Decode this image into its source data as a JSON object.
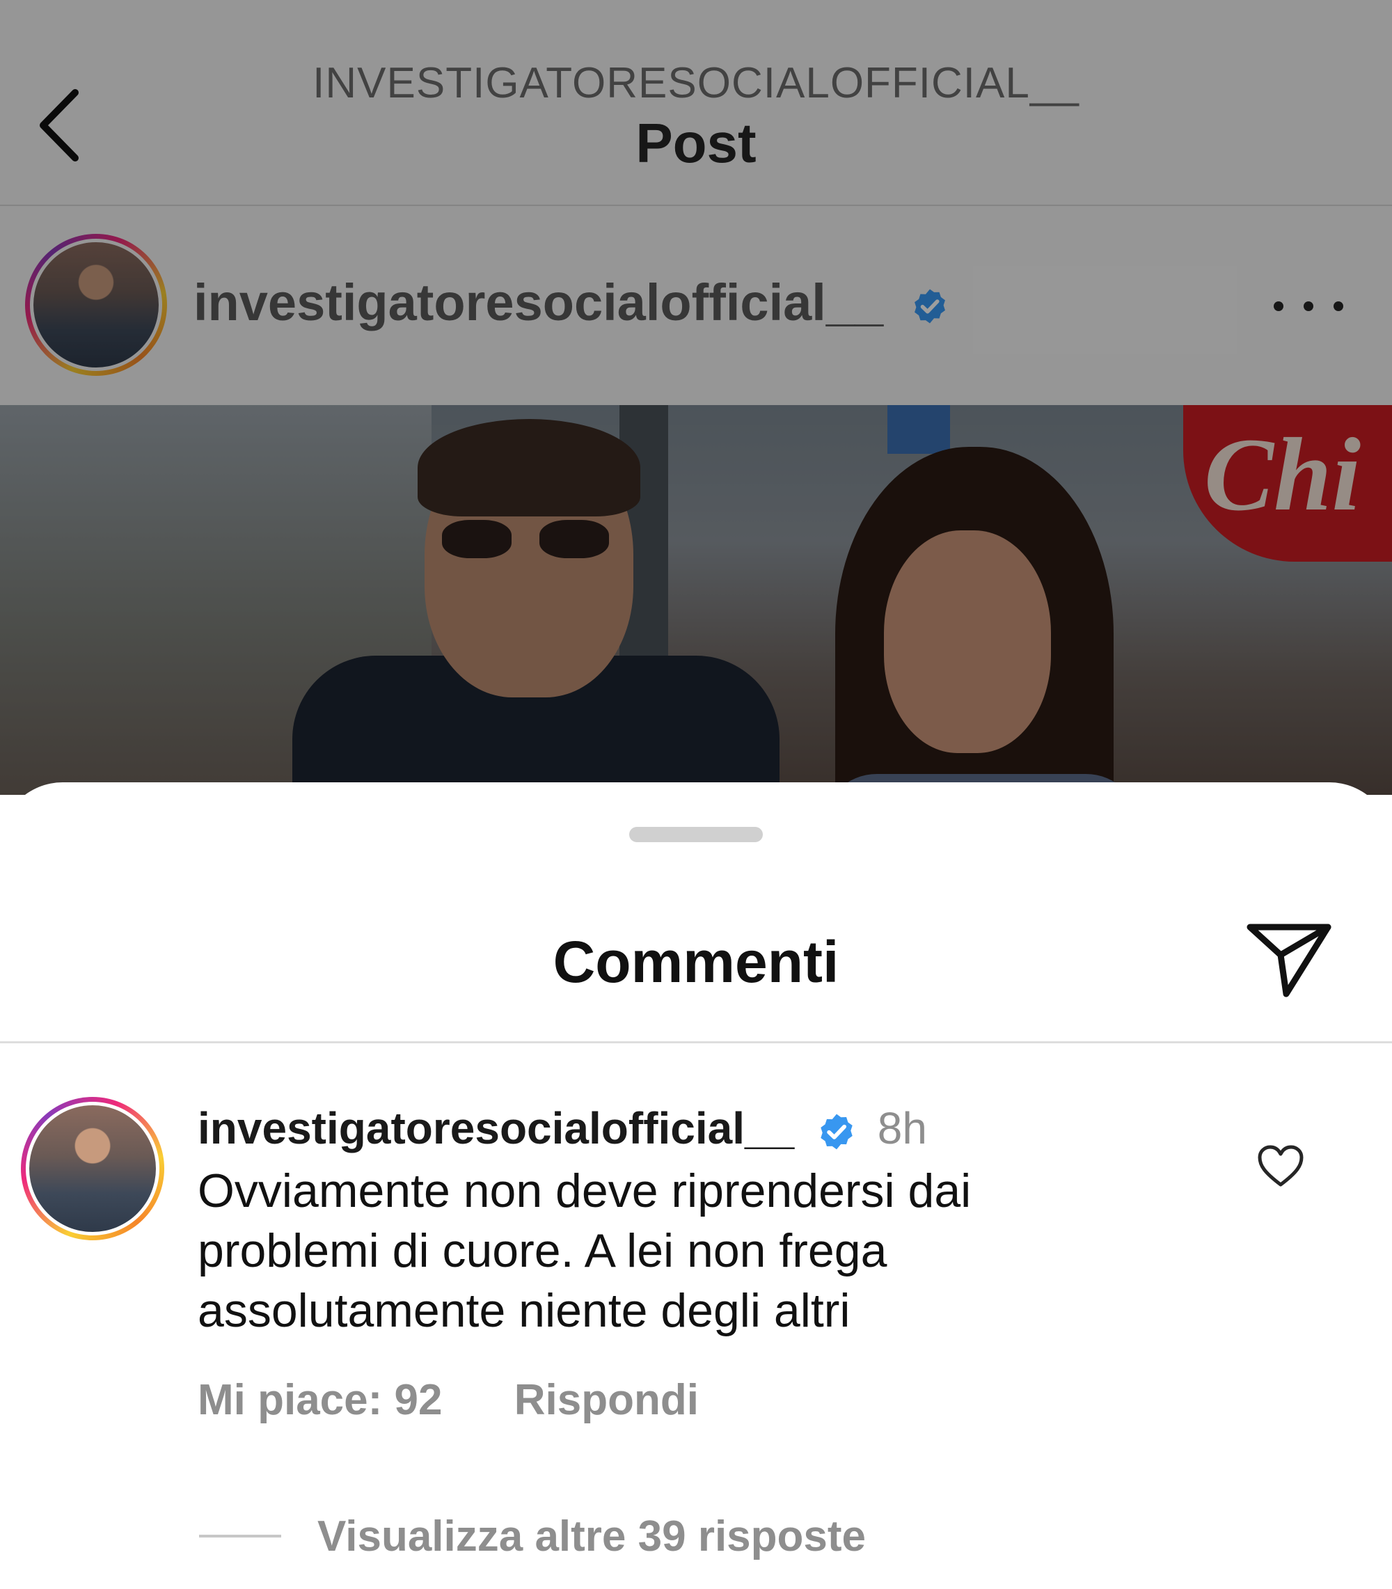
{
  "header": {
    "account_name": "INVESTIGATORESOCIALOFFICIAL__",
    "title": "Post"
  },
  "post": {
    "username": "investigatoresocialofficial__",
    "verified": true,
    "image_logo_text": "Chi"
  },
  "comments_sheet": {
    "title": "Commenti",
    "comment": {
      "username": "investigatoresocialofficial__",
      "verified": true,
      "time": "8h",
      "text": "Ovviamente non deve riprendersi dai problemi di cuore. A lei non frega assolutamente niente degli altri",
      "likes_label": "Mi piace: 92",
      "reply_label": "Rispondi"
    },
    "view_replies_label": "Visualizza altre 39 risposte"
  },
  "icons": {
    "back": "chevron-left-icon",
    "verified": "verified-badge-icon",
    "more": "more-options-icon",
    "share": "send-icon",
    "like": "heart-icon"
  },
  "colors": {
    "verified_blue": "#3897f0",
    "muted_text": "#8e8e8e",
    "primary_text": "#111111"
  }
}
